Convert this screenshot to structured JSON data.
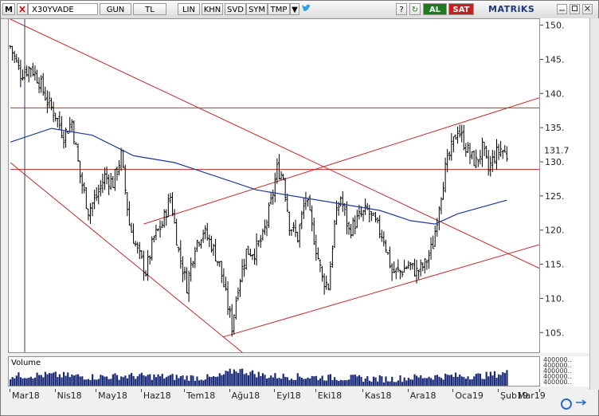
{
  "toolbar": {
    "m_label": "M",
    "symbol": "X30YVADE",
    "period": "GUN",
    "currency": "TL",
    "buttons": [
      "LIN",
      "KHN",
      "SVD",
      "SYM",
      "TMP"
    ],
    "buy_label": "AL",
    "sell_label": "SAT",
    "brand": "MATRiKS",
    "buy_color": "#1e7a1e",
    "sell_color": "#c81e1e"
  },
  "volume_label": "Volume",
  "volume_axis_label": "400000..",
  "chart_data": {
    "type": "ohlc",
    "symbol": "X30YVADE",
    "ylim": [
      102,
      151
    ],
    "yticks": [
      105,
      110,
      115,
      120,
      125,
      130,
      135,
      140,
      145,
      150
    ],
    "ytick_labels": [
      "105.",
      "110.",
      "115.",
      "120.",
      "125.",
      "130.",
      "135.",
      "140.",
      "145.",
      "150."
    ],
    "last_price_label": "131.7",
    "last_price": 131.7,
    "xlabels": [
      "Mar18",
      "Nis18",
      "May18",
      "Haz18",
      "Tem18",
      "Ağu18",
      "Eyl18",
      "Eki18",
      "Kas18",
      "Ara18",
      "Oca19",
      "Şub19",
      "Mar19"
    ],
    "month_start_index": [
      0,
      22,
      42,
      64,
      85,
      107,
      129,
      149,
      172,
      194,
      216,
      238,
      258
    ],
    "n_bars": 258,
    "price_anchors": [
      [
        0,
        147
      ],
      [
        5,
        143
      ],
      [
        10,
        144
      ],
      [
        14,
        142
      ],
      [
        18,
        139
      ],
      [
        22,
        137
      ],
      [
        26,
        134
      ],
      [
        30,
        136
      ],
      [
        34,
        128
      ],
      [
        38,
        123
      ],
      [
        42,
        125
      ],
      [
        46,
        128
      ],
      [
        50,
        127
      ],
      [
        54,
        131
      ],
      [
        58,
        121
      ],
      [
        62,
        117
      ],
      [
        66,
        114
      ],
      [
        70,
        119
      ],
      [
        74,
        121
      ],
      [
        78,
        125
      ],
      [
        82,
        117
      ],
      [
        86,
        112
      ],
      [
        90,
        118
      ],
      [
        94,
        120
      ],
      [
        98,
        118
      ],
      [
        102,
        115
      ],
      [
        106,
        109
      ],
      [
        108,
        106
      ],
      [
        111,
        112
      ],
      [
        115,
        117
      ],
      [
        119,
        117
      ],
      [
        123,
        119
      ],
      [
        127,
        124
      ],
      [
        130,
        129
      ],
      [
        133,
        128
      ],
      [
        136,
        121
      ],
      [
        140,
        119
      ],
      [
        144,
        125
      ],
      [
        148,
        119
      ],
      [
        152,
        113
      ],
      [
        155,
        112
      ],
      [
        158,
        121
      ],
      [
        161,
        125
      ],
      [
        165,
        120
      ],
      [
        170,
        122
      ],
      [
        174,
        123
      ],
      [
        178,
        121
      ],
      [
        182,
        119
      ],
      [
        186,
        114
      ],
      [
        190,
        114
      ],
      [
        194,
        115
      ],
      [
        198,
        114
      ],
      [
        202,
        115
      ],
      [
        206,
        118
      ],
      [
        209,
        124
      ],
      [
        212,
        129
      ],
      [
        215,
        132
      ],
      [
        218,
        135
      ],
      [
        221,
        133
      ],
      [
        224,
        131
      ],
      [
        227,
        130
      ],
      [
        230,
        132
      ],
      [
        233,
        129
      ],
      [
        236,
        131
      ],
      [
        239,
        132
      ],
      [
        242,
        131
      ]
    ],
    "ma": [
      [
        0,
        133
      ],
      [
        20,
        135
      ],
      [
        40,
        134
      ],
      [
        60,
        131
      ],
      [
        80,
        130
      ],
      [
        100,
        128
      ],
      [
        120,
        126
      ],
      [
        140,
        125
      ],
      [
        160,
        124
      ],
      [
        180,
        123
      ],
      [
        195,
        121.5
      ],
      [
        207,
        121
      ],
      [
        218,
        122.5
      ],
      [
        230,
        123.5
      ],
      [
        242,
        124.5
      ]
    ],
    "volume_anchors": [
      [
        0,
        0.55
      ],
      [
        20,
        0.6
      ],
      [
        40,
        0.5
      ],
      [
        60,
        0.55
      ],
      [
        80,
        0.5
      ],
      [
        100,
        0.45
      ],
      [
        110,
        0.85
      ],
      [
        125,
        0.55
      ],
      [
        145,
        0.5
      ],
      [
        165,
        0.45
      ],
      [
        185,
        0.4
      ],
      [
        200,
        0.5
      ],
      [
        215,
        0.55
      ],
      [
        230,
        0.55
      ],
      [
        242,
        0.7
      ]
    ],
    "red_lines": [
      {
        "from": [
          0,
          151
        ],
        "to": [
          258,
          114.5
        ]
      },
      {
        "from": [
          0,
          130
        ],
        "to": [
          120,
          100.5
        ]
      },
      {
        "from": [
          104,
          104.5
        ],
        "to": [
          258,
          118
        ]
      },
      {
        "from": [
          65,
          121
        ],
        "to": [
          258,
          139.5
        ]
      },
      {
        "from": [
          0,
          138
        ],
        "to": [
          258,
          138
        ]
      },
      {
        "from": [
          0,
          129
        ],
        "to": [
          258,
          129
        ]
      }
    ],
    "cursor_index": 7,
    "colors": {
      "bars": "#000000",
      "ma": "#1e3a9a",
      "lines": "#c82828"
    }
  }
}
